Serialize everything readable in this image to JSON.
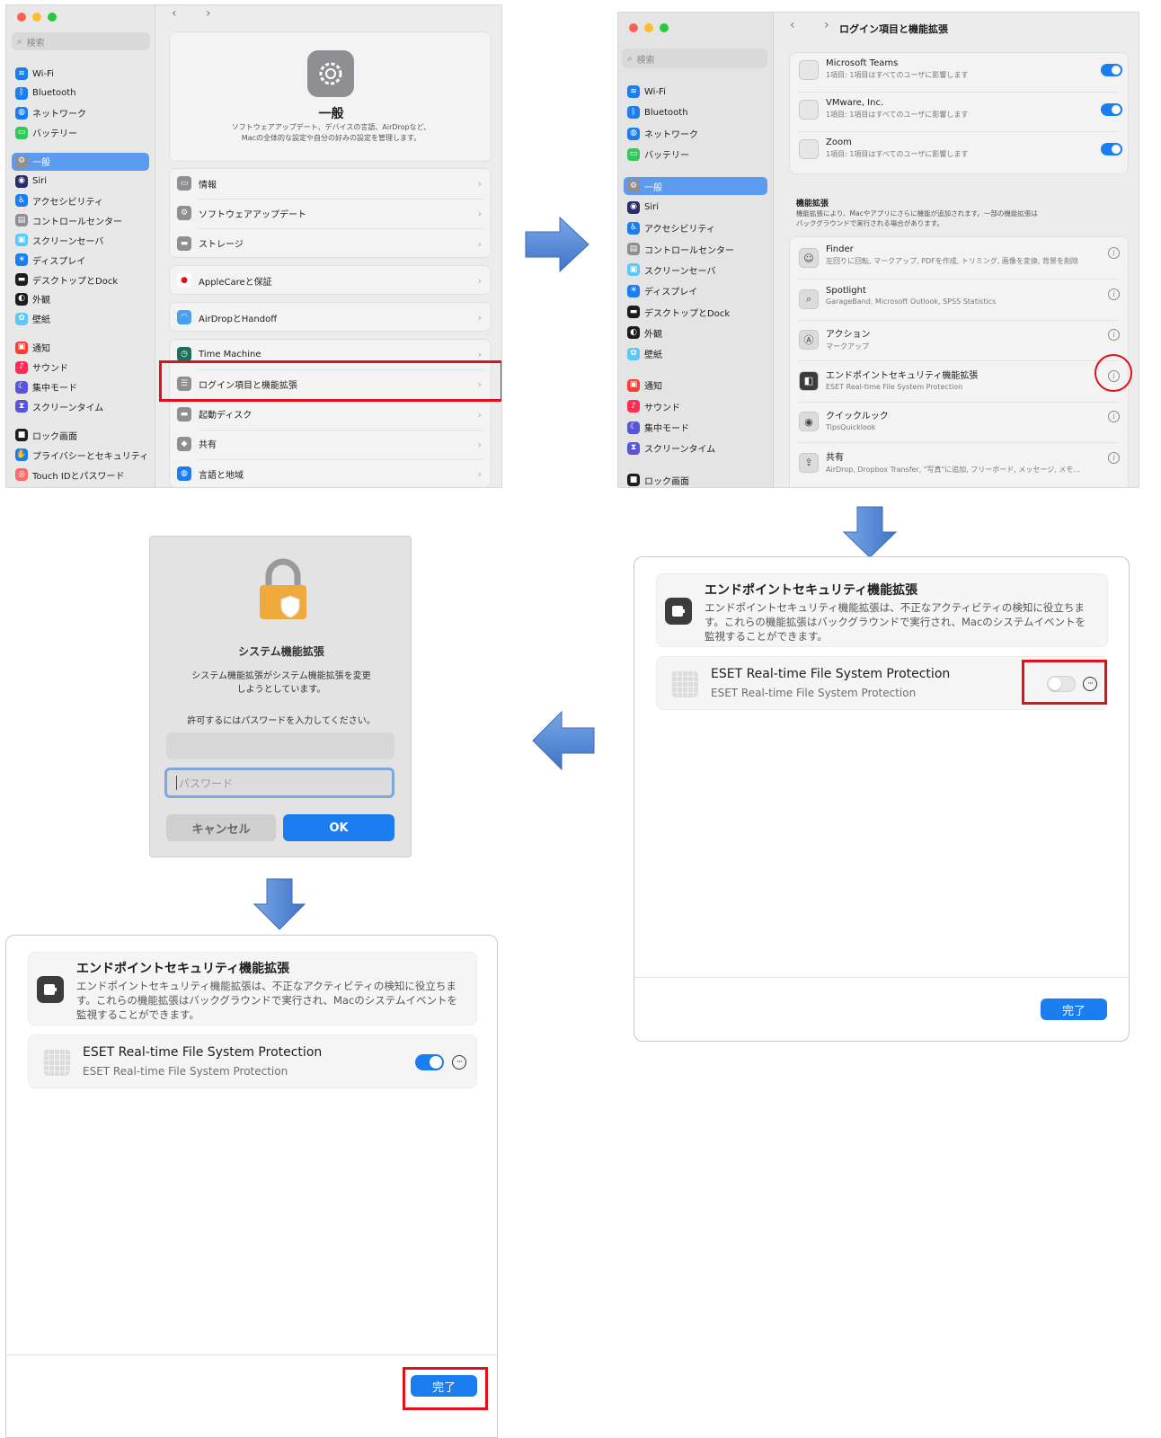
{
  "colors": {
    "accent": "#1a7df0",
    "highlight": "#e0111b",
    "arrow": "#5b8fd6"
  },
  "panel1": {
    "search_placeholder": "検索",
    "sidebar": [
      {
        "label": "Wi-Fi",
        "icon": "wifi-icon",
        "color": "#1a7df0"
      },
      {
        "label": "Bluetooth",
        "icon": "bluetooth-icon",
        "color": "#1a7df0"
      },
      {
        "label": "ネットワーク",
        "icon": "globe-icon",
        "color": "#1a7df0"
      },
      {
        "label": "バッテリー",
        "icon": "battery-icon",
        "color": "#34c759"
      },
      {
        "label": "一般",
        "icon": "gear-icon",
        "color": "#8e8e93"
      },
      {
        "label": "Siri",
        "icon": "siri-icon",
        "color": "#2b2b6b"
      },
      {
        "label": "アクセシビリティ",
        "icon": "accessibility-icon",
        "color": "#1a7df0"
      },
      {
        "label": "コントロールセンター",
        "icon": "control-center-icon",
        "color": "#8e8e93"
      },
      {
        "label": "スクリーンセーバ",
        "icon": "screensaver-icon",
        "color": "#5ac8fa"
      },
      {
        "label": "ディスプレイ",
        "icon": "display-icon",
        "color": "#1a7df0"
      },
      {
        "label": "デスクトップとDock",
        "icon": "dock-icon",
        "color": "#1d1d1f"
      },
      {
        "label": "外観",
        "icon": "appearance-icon",
        "color": "#1d1d1f"
      },
      {
        "label": "壁紙",
        "icon": "wallpaper-icon",
        "color": "#5ac8fa"
      },
      {
        "label": "通知",
        "icon": "notification-icon",
        "color": "#ff3b30"
      },
      {
        "label": "サウンド",
        "icon": "sound-icon",
        "color": "#ff2d55"
      },
      {
        "label": "集中モード",
        "icon": "focus-icon",
        "color": "#5856d6"
      },
      {
        "label": "スクリーンタイム",
        "icon": "screentime-icon",
        "color": "#5856d6"
      },
      {
        "label": "ロック画面",
        "icon": "lock-icon",
        "color": "#1d1d1f"
      },
      {
        "label": "プライバシーとセキュリティ",
        "icon": "privacy-icon",
        "color": "#1a7df0"
      },
      {
        "label": "Touch IDとパスワード",
        "icon": "touchid-icon",
        "color": "#ff6b6b"
      }
    ],
    "header_title": "一般",
    "header_desc_1": "ソフトウェアアップデート、デバイスの言語、AirDropなど、",
    "header_desc_2": "Macの全体的な設定や自分の好みの設定を管理します。",
    "rows": [
      {
        "label": "情報",
        "icon": "info-icon"
      },
      {
        "label": "ソフトウェアアップデート",
        "icon": "update-icon"
      },
      {
        "label": "ストレージ",
        "icon": "storage-icon"
      },
      {
        "label": "AppleCareと保証",
        "icon": "apple-icon"
      },
      {
        "label": "AirDropとHandoff",
        "icon": "airdrop-icon"
      },
      {
        "label": "Time Machine",
        "icon": "timemachine-icon"
      },
      {
        "label": "ログイン項目と機能拡張",
        "icon": "list-icon"
      },
      {
        "label": "起動ディスク",
        "icon": "disk-icon"
      },
      {
        "label": "共有",
        "icon": "share-icon"
      },
      {
        "label": "言語と地域",
        "icon": "globe-icon"
      }
    ]
  },
  "panel2": {
    "title": "ログイン項目と機能拡張",
    "search_placeholder": "検索",
    "sidebar": [
      {
        "label": "Wi-Fi",
        "icon": "wifi-icon",
        "color": "#1a7df0"
      },
      {
        "label": "Bluetooth",
        "icon": "bluetooth-icon",
        "color": "#1a7df0"
      },
      {
        "label": "ネットワーク",
        "icon": "globe-icon",
        "color": "#1a7df0"
      },
      {
        "label": "バッテリー",
        "icon": "battery-icon",
        "color": "#34c759"
      },
      {
        "label": "一般",
        "icon": "gear-icon",
        "color": "#8e8e93"
      },
      {
        "label": "Siri",
        "icon": "siri-icon",
        "color": "#2b2b6b"
      },
      {
        "label": "アクセシビリティ",
        "icon": "accessibility-icon",
        "color": "#1a7df0"
      },
      {
        "label": "コントロールセンター",
        "icon": "control-center-icon",
        "color": "#8e8e93"
      },
      {
        "label": "スクリーンセーバ",
        "icon": "screensaver-icon",
        "color": "#5ac8fa"
      },
      {
        "label": "ディスプレイ",
        "icon": "display-icon",
        "color": "#1a7df0"
      },
      {
        "label": "デスクトップとDock",
        "icon": "dock-icon",
        "color": "#1d1d1f"
      },
      {
        "label": "外観",
        "icon": "appearance-icon",
        "color": "#1d1d1f"
      },
      {
        "label": "壁紙",
        "icon": "wallpaper-icon",
        "color": "#5ac8fa"
      },
      {
        "label": "通知",
        "icon": "notification-icon",
        "color": "#ff3b30"
      },
      {
        "label": "サウンド",
        "icon": "sound-icon",
        "color": "#ff2d55"
      },
      {
        "label": "集中モード",
        "icon": "focus-icon",
        "color": "#5856d6"
      },
      {
        "label": "スクリーンタイム",
        "icon": "screentime-icon",
        "color": "#5856d6"
      },
      {
        "label": "ロック画面",
        "icon": "lock-icon",
        "color": "#1d1d1f"
      }
    ],
    "login_items": [
      {
        "name": "Microsoft Teams",
        "sub": "1項目: 1項目はすべてのユーザに影響します",
        "enabled": true
      },
      {
        "name": "VMware, Inc.",
        "sub": "1項目: 1項目はすべてのユーザに影響します",
        "enabled": true
      },
      {
        "name": "Zoom",
        "sub": "1項目: 1項目はすべてのユーザに影響します",
        "enabled": true
      }
    ],
    "ext_section_title": "機能拡張",
    "ext_section_desc_1": "機能拡張により、Macやアプリにさらに機能が追加されます。一部の機能拡張は",
    "ext_section_desc_2": "バックグラウンドで実行される場合があります。",
    "extensions": [
      {
        "name": "Finder",
        "sub": "左回りに回転, マークアップ, PDFを作成, トリミング, 画像を変換, 背景を削除",
        "icon": "finder-icon"
      },
      {
        "name": "Spotlight",
        "sub": "GarageBand, Microsoft Outlook, SPSS Statistics",
        "icon": "search-icon"
      },
      {
        "name": "アクション",
        "sub": "マークアップ",
        "icon": "action-icon"
      },
      {
        "name": "エンドポイントセキュリティ機能拡張",
        "sub": "ESET Real-time File System Protection",
        "icon": "extension-icon"
      },
      {
        "name": "クイックルック",
        "sub": "TipsQuicklook",
        "icon": "eye-icon"
      },
      {
        "name": "共有",
        "sub": "AirDrop, Dropbox Transfer, \"写真\"に追加, フリーボード, メッセージ, メモ...",
        "icon": "share-icon"
      }
    ]
  },
  "dialog_endpoint": {
    "title": "エンドポイントセキュリティ機能拡張",
    "desc_1": "エンドポイントセキュリティ機能拡張は、不正なアクティビティの検知に役立ちま",
    "desc_2": "す。これらの機能拡張はバックグラウンドで実行され、Macのシステムイベントを",
    "desc_3": "監視することができます。",
    "item_name": "ESET Real-time File System Protection",
    "item_sub": "ESET Real-time File System Protection",
    "done_label": "完了",
    "toggle_before": false,
    "toggle_after": true
  },
  "panel4": {
    "title": "システム機能拡張",
    "message_1": "システム機能拡張がシステム機能拡張を変更",
    "message_2": "しようとしています。",
    "prompt": "許可するにはパスワードを入力してください。",
    "password_placeholder": "パスワード",
    "cancel_label": "キャンセル",
    "ok_label": "OK"
  }
}
